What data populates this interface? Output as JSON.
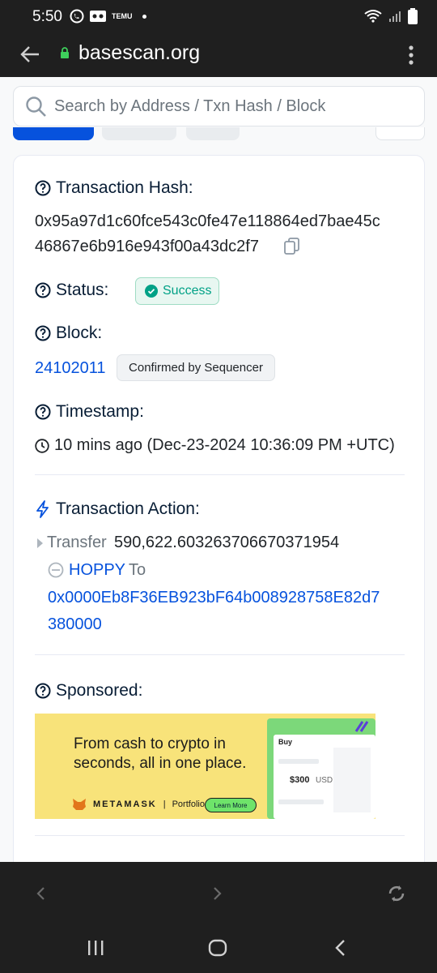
{
  "status_bar": {
    "time": "5:50",
    "app_label": "TEMU"
  },
  "browser": {
    "url": "basescan.org"
  },
  "search": {
    "placeholder": "Search by Address / Txn Hash / Block"
  },
  "transaction": {
    "hash_label": "Transaction Hash:",
    "hash_line1": "0x95a97d1c60fce543c0fe47e118864ed7bae45c",
    "hash_line2": "46867e6b916e943f00a43dc2f7",
    "status_label": "Status:",
    "status_value": "Success",
    "block_label": "Block:",
    "block_value": "24102011",
    "block_badge": "Confirmed by Sequencer",
    "timestamp_label": "Timestamp:",
    "timestamp_value": "10 mins ago (Dec-23-2024 10:36:09 PM +UTC)",
    "action_label": "Transaction Action:",
    "action_verb": "Transfer",
    "action_amount": "590,622.603263706670371954",
    "action_token": "HOPPY",
    "action_to": "To",
    "action_address_line1": "0x0000Eb8F36EB923bF64b008928758E82d7",
    "action_address_line2": "380000",
    "sponsored_label": "Sponsored:"
  },
  "ad": {
    "headline": "From cash to crypto in seconds, all in one place.",
    "brand": "METAMASK",
    "product": "Portfolio",
    "cta": "Learn More",
    "panel_title": "Buy",
    "panel_amount": "$300",
    "panel_currency": "USD"
  },
  "colors": {
    "accent": "#0652dd",
    "success": "#00a186",
    "chrome": "#1f1f1f"
  }
}
